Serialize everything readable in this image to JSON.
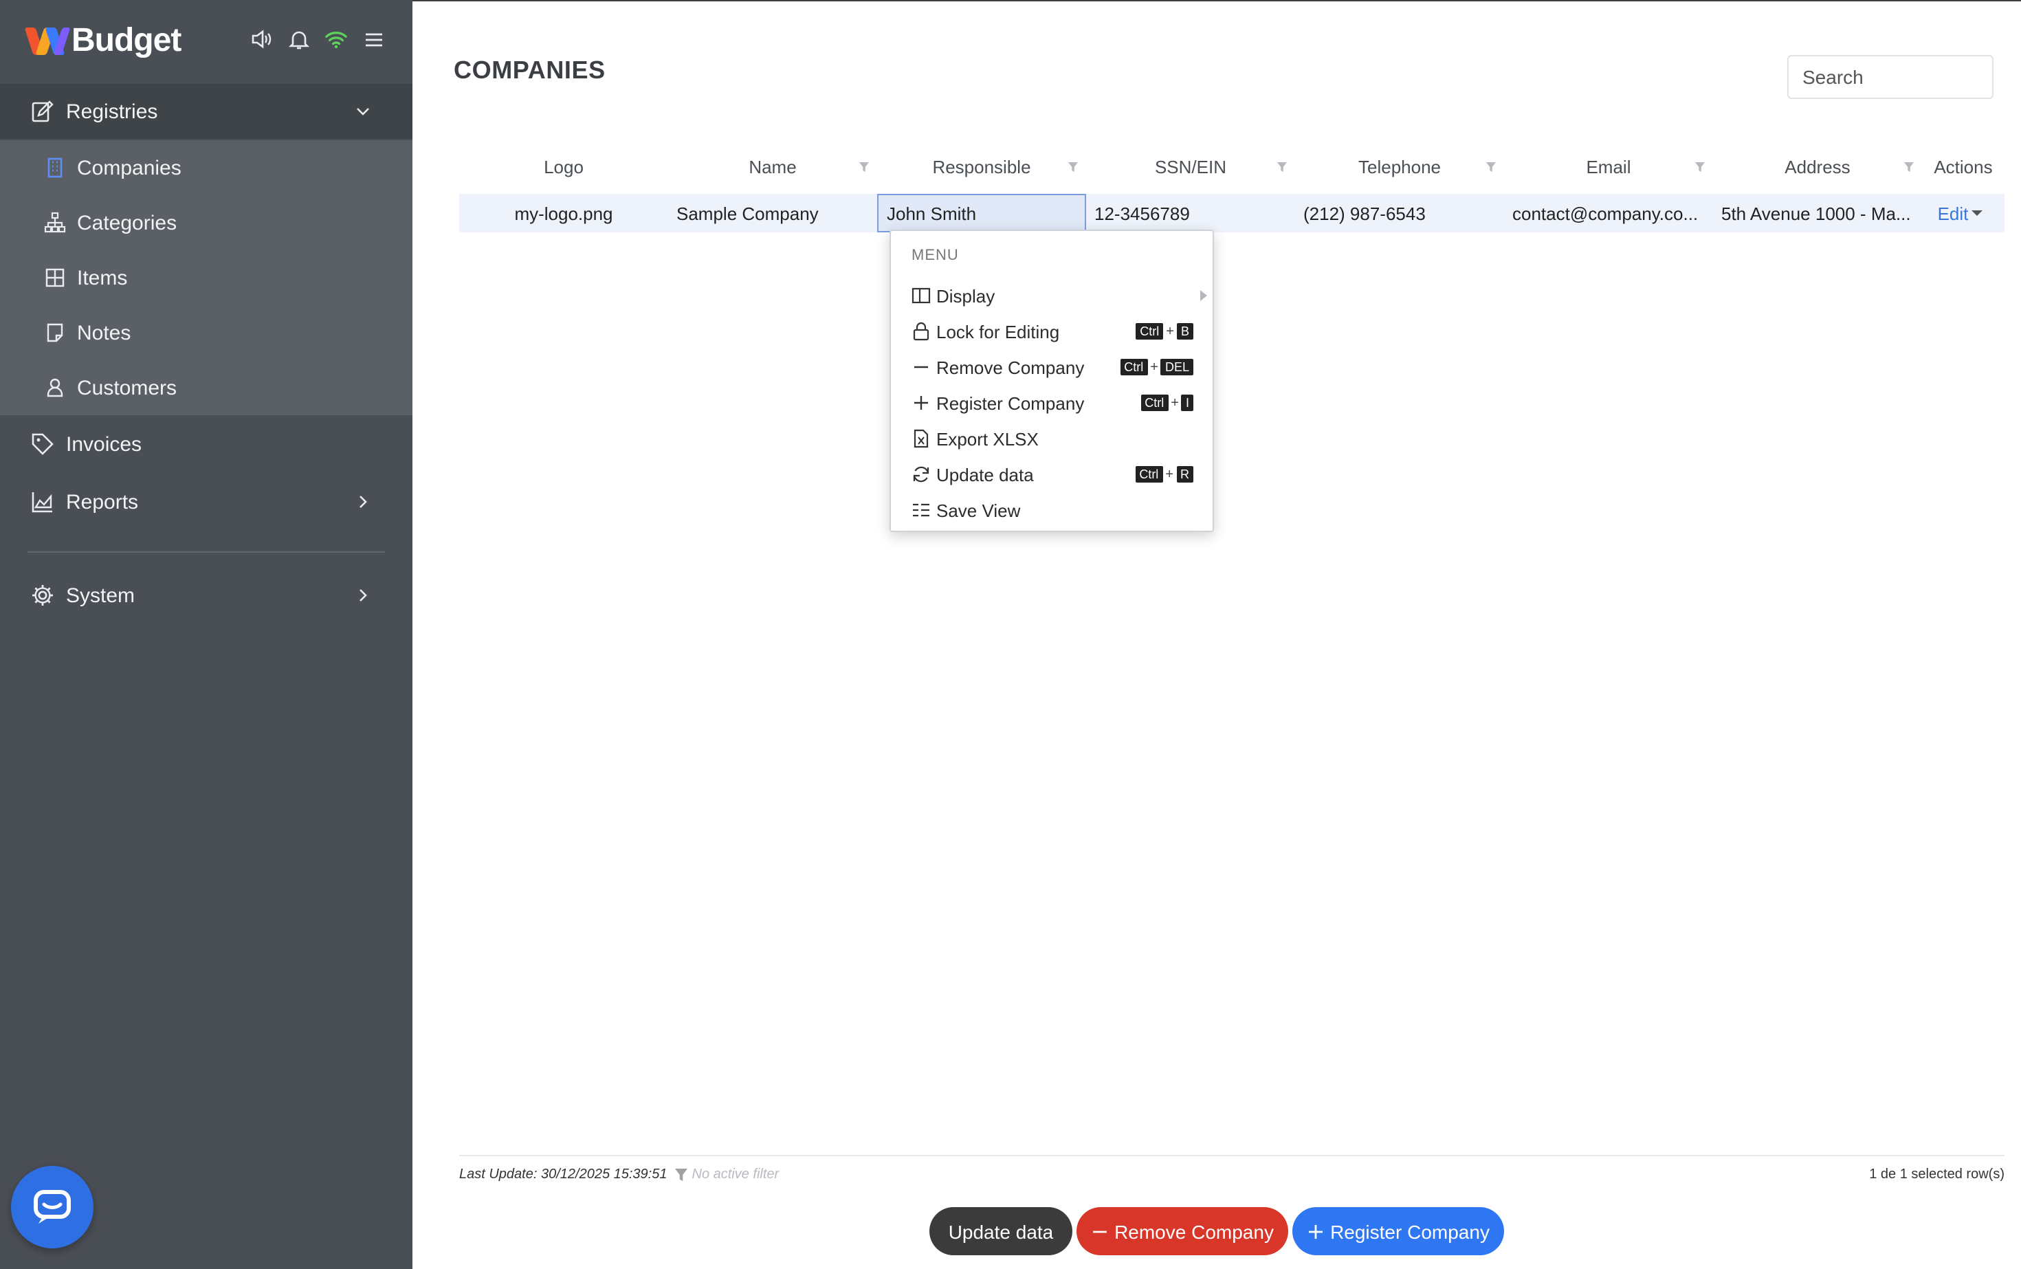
{
  "brand": {
    "name": "Budget"
  },
  "sidebar": {
    "registries": "Registries",
    "sub_items": [
      {
        "label": "Companies",
        "icon": "building-icon"
      },
      {
        "label": "Categories",
        "icon": "hierarchy-icon"
      },
      {
        "label": "Items",
        "icon": "grid-icon"
      },
      {
        "label": "Notes",
        "icon": "note-icon"
      },
      {
        "label": "Customers",
        "icon": "user-icon"
      }
    ],
    "invoices": "Invoices",
    "reports": "Reports",
    "system": "System"
  },
  "page": {
    "title": "COMPANIES",
    "search_placeholder": "Search"
  },
  "table": {
    "columns": [
      "Logo",
      "Name",
      "Responsible",
      "SSN/EIN",
      "Telephone",
      "Email",
      "Address",
      "Actions"
    ],
    "row": {
      "logo": "my-logo.png",
      "name": "Sample Company",
      "responsible": "John Smith",
      "ssn": "12-3456789",
      "telephone": "(212) 987-6543",
      "email": "contact@company.co...",
      "address": "5th Avenue 1000 - Ma...",
      "action": "Edit"
    }
  },
  "context_menu": {
    "title": "MENU",
    "items": [
      {
        "label": "Display",
        "icon": "columns-icon"
      },
      {
        "label": "Lock for Editing",
        "icon": "lock-icon",
        "keys": [
          "Ctrl",
          "B"
        ]
      },
      {
        "label": "Remove Company",
        "icon": "minus-icon",
        "keys": [
          "Ctrl",
          "DEL"
        ]
      },
      {
        "label": "Register Company",
        "icon": "plus-icon",
        "keys": [
          "Ctrl",
          "I"
        ]
      },
      {
        "label": "Export XLSX",
        "icon": "excel-file-icon"
      },
      {
        "label": "Update data",
        "icon": "refresh-icon",
        "keys": [
          "Ctrl",
          "R"
        ]
      },
      {
        "label": "Save View",
        "icon": "list-view-icon"
      }
    ]
  },
  "footer": {
    "last_update": "Last Update: 30/12/2025 15:39:51",
    "filter_status": "No active filter",
    "selection": "1 de 1 selected row(s)"
  },
  "buttons": {
    "update": "Update data",
    "remove": "Remove Company",
    "register": "Register Company"
  },
  "colors": {
    "sidebar": "#4a4f55",
    "primary": "#2e76f2",
    "danger": "#d9362a",
    "dark": "#3b3b3b",
    "wifi": "#5dd35a"
  }
}
